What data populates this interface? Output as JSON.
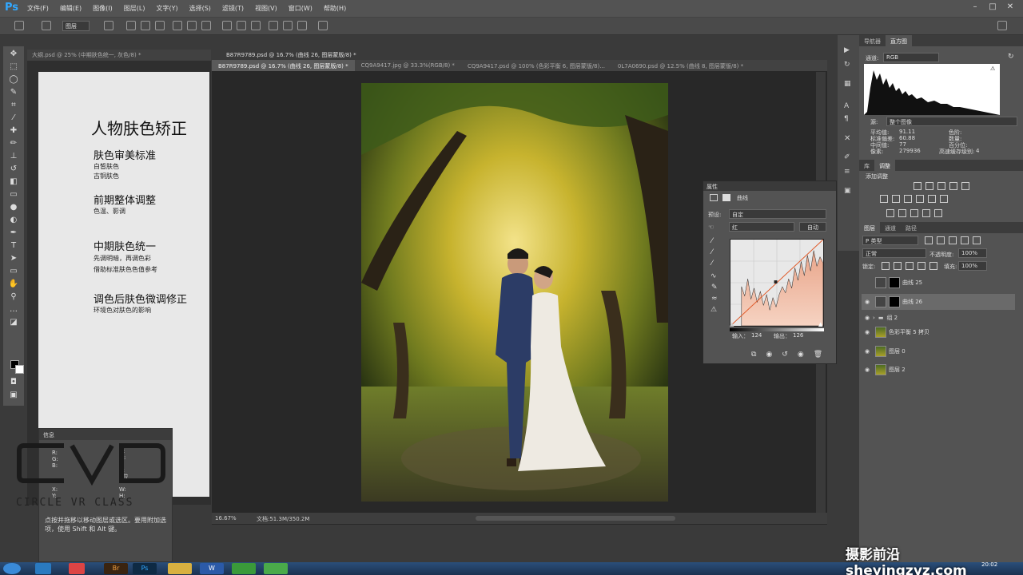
{
  "app": {
    "logo": "Ps"
  },
  "menu": [
    "文件(F)",
    "编辑(E)",
    "图像(I)",
    "图层(L)",
    "文字(Y)",
    "选择(S)",
    "滤镜(T)",
    "视图(V)",
    "窗口(W)",
    "帮助(H)"
  ],
  "optbar": {
    "mode": "图层"
  },
  "doc1": {
    "tab": "大纲.psd @ 25% (中期肤色统一, 灰色/8) *",
    "title": "人物肤色矫正",
    "sections": [
      {
        "heading": "肤色审美标准",
        "lines": [
          "白皙肤色",
          "古铜肤色"
        ]
      },
      {
        "heading": "前期整体调整",
        "lines": [
          "色温、影调"
        ]
      },
      {
        "heading": "中期肤色统一",
        "lines": [
          "先调明暗，再调色彩",
          "借助标准肤色色值参考"
        ]
      },
      {
        "heading": "调色后肤色微调修正",
        "lines": [
          "环境色对肤色的影响"
        ]
      }
    ]
  },
  "info": {
    "title": "信息",
    "labels": [
      "R:",
      "G:",
      "B:",
      "C:",
      "M:",
      "Y:",
      "K:",
      "8位",
      "X:",
      "Y:",
      "W:",
      "H:"
    ],
    "hint": "点按并拖移以移动图层或选区。要用附加选项，使用 Shift 和 Alt 键。"
  },
  "logo": {
    "text": "CIRCLE VR CLASS"
  },
  "doc2": {
    "window_title": "B87R9789.psd @ 16.7% (曲线 26, 图层蒙版/8) *",
    "tabs": [
      "B87R9789.psd @ 16.7% (曲线 26, 图层蒙版/8) *",
      "CQ9A9417.jpg @ 33.3%(RGB/8) *",
      "CQ9A9417.psd @ 100% (色彩平衡 6, 图层蒙版/8)...",
      "0L7A0690.psd @ 12.5% (曲线 8, 图层蒙版/8) *"
    ],
    "zoom": "16.67%",
    "doc_size": "文档:51.3M/350.2M"
  },
  "properties": {
    "title": "属性",
    "panel_name": "曲线",
    "preset_label": "预设:",
    "preset_value": "自定",
    "channel": "红",
    "auto": "自动",
    "input_label": "输入：",
    "input_value": "124",
    "output_label": "输出：",
    "output_value": "126"
  },
  "navigator": {
    "tabs": [
      "导航器",
      "直方图"
    ]
  },
  "histogram": {
    "channel_label": "通道:",
    "channel": "RGB",
    "source_label": "源:",
    "source": "整个图像",
    "stats": [
      [
        "平均值:",
        "91.11",
        "色阶:",
        ""
      ],
      [
        "标准偏差:",
        "60.88",
        "数量:",
        ""
      ],
      [
        "中间值:",
        "77",
        "百分位:",
        ""
      ],
      [
        "像素:",
        "279936",
        "高速缓存级别:",
        "4"
      ]
    ]
  },
  "adjust": {
    "tabs": [
      "库",
      "调整"
    ],
    "add_label": "添加调整"
  },
  "layers": {
    "tabs": [
      "图层",
      "通道",
      "路径"
    ],
    "kind": "P 类型",
    "blend": "正常",
    "opacity_label": "不透明度:",
    "opacity": "100%",
    "lock_label": "锁定:",
    "fill_label": "填充:",
    "fill": "100%",
    "items": [
      {
        "name": "曲线 25",
        "visible": false,
        "type": "adj"
      },
      {
        "name": "曲线 26",
        "visible": true,
        "type": "adj",
        "selected": true
      },
      {
        "name": "组 2",
        "visible": true,
        "type": "group"
      },
      {
        "name": "色彩平衡 5 拷贝",
        "visible": true,
        "type": "img"
      },
      {
        "name": "图层 0",
        "visible": true,
        "type": "img"
      },
      {
        "name": "图层 2",
        "visible": true,
        "type": "img"
      }
    ]
  },
  "taskbar": {
    "buttons": [
      "Br",
      "Ps",
      "W"
    ],
    "clock": "20:02"
  },
  "watermark": "摄影前沿 sheyingzyz.com",
  "colors": {
    "ps_blue": "#31a8ff",
    "panel": "#535353",
    "curve_fill": "#f0c0a8"
  }
}
